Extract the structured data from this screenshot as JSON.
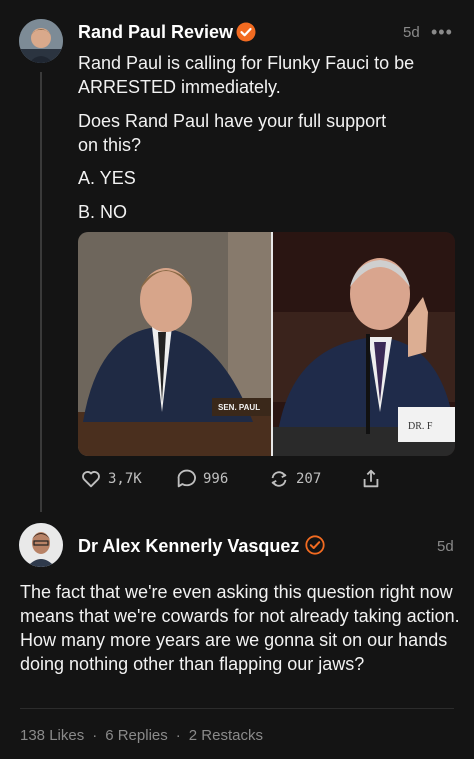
{
  "original_post": {
    "author": "Rand Paul Review",
    "time": "5d",
    "paragraphs": [
      "Rand Paul is calling for Flunky Fauci to be ARRESTED immediately.",
      "Does Rand Paul have your full support on this?",
      "A. YES",
      "B. NO"
    ],
    "image_caption_left": "SEN. PAUL",
    "image_caption_right": "DR. F",
    "actions": {
      "likes": "3,7K",
      "comments": "996",
      "restacks": "207"
    }
  },
  "reply": {
    "author": "Dr Alex Kennerly Vasquez",
    "time": "5d",
    "text": "The fact that we're even asking this question right now means that we're cowards for not already taking action. How many more years are we gonna sit on our hands doing nothing other than flapping our jaws?",
    "stats": {
      "likes": "138 Likes",
      "replies": "6 Replies",
      "restacks": "2 Restacks"
    }
  },
  "colors": {
    "background": "#141414",
    "accent": "#f26b21",
    "muted_text": "#8a8a8a"
  },
  "icons": [
    "heart-icon",
    "comment-icon",
    "restack-icon",
    "share-icon",
    "verified-badge-icon",
    "more-icon"
  ]
}
